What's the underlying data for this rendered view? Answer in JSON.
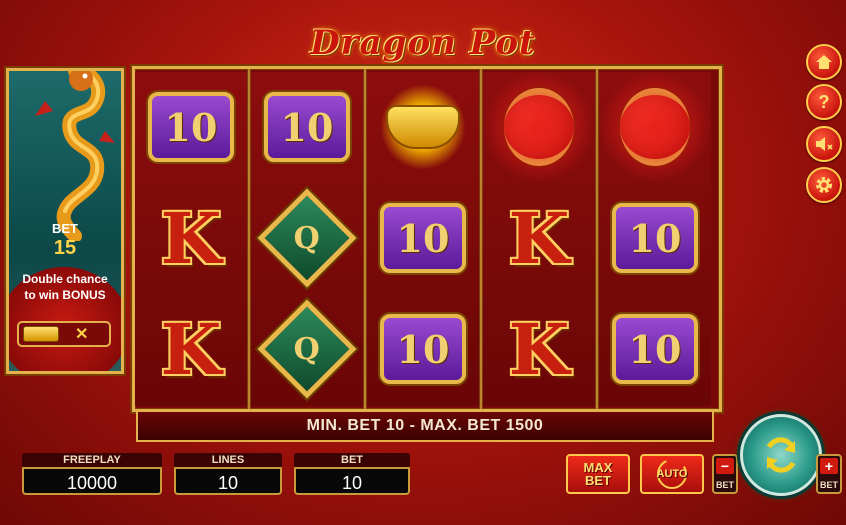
{
  "title": "Dragon Pot",
  "promo": {
    "bet_label": "BET",
    "bet_value": "15",
    "line1": "Double chance",
    "line2": "to win BONUS",
    "toggle_x": "✕"
  },
  "reels": [
    [
      "10",
      "K",
      "K"
    ],
    [
      "10",
      "Q",
      "Q"
    ],
    [
      "ingot",
      "10",
      "10"
    ],
    [
      "lantern",
      "K",
      "K"
    ],
    [
      "lantern",
      "10",
      "10"
    ]
  ],
  "symbols": {
    "ten": "10",
    "k": "K",
    "q": "Q"
  },
  "bet_bar": "MIN. BET 10 - MAX. BET 1500",
  "side_buttons": [
    "home-icon",
    "help-icon",
    "sound-off-icon",
    "gear-icon"
  ],
  "help_glyph": "?",
  "panels": {
    "freeplay_label": "FREEPLAY",
    "freeplay_value": "10000",
    "lines_label": "LINES",
    "lines_value": "10",
    "bet_label": "BET",
    "bet_value": "10"
  },
  "buttons": {
    "max_bet_1": "MAX",
    "max_bet_2": "BET",
    "auto": "AUTO",
    "bet_minus_sign": "−",
    "bet_minus_word": "BET",
    "bet_plus_sign": "+",
    "bet_plus_word": "BET"
  },
  "colors": {
    "gold": "#e3b24a",
    "red": "#c8140c",
    "spin_teal": "#2a9a8a"
  }
}
